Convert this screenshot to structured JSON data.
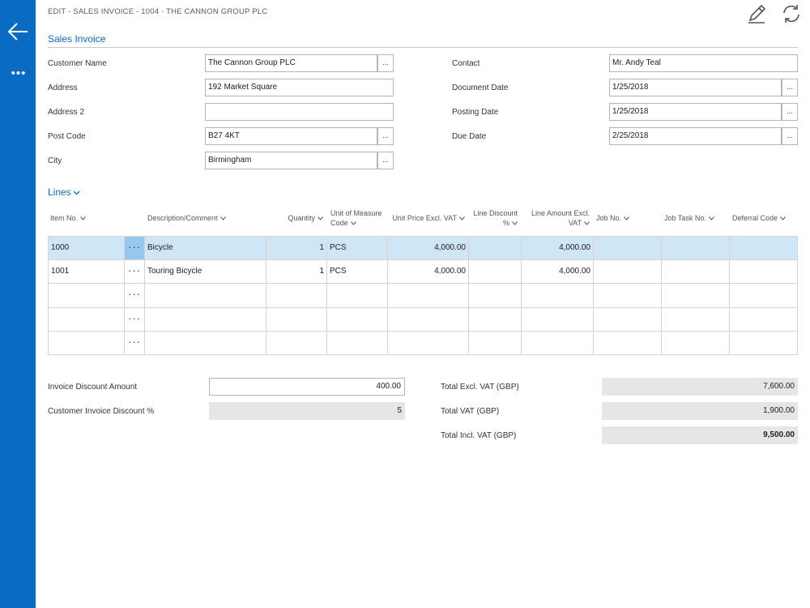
{
  "breadcrumb": "EDIT - SALES INVOICE - 1004 · THE CANNON GROUP PLC",
  "icons": {
    "back": "arrow-left-icon",
    "more": "ellipsis-icon",
    "edit": "pencil-icon",
    "refresh": "refresh-icon"
  },
  "sidebar": {
    "more_label": "•••"
  },
  "section": {
    "title": "Sales Invoice"
  },
  "fields": {
    "customer_name": {
      "label": "Customer Name",
      "value": "The Cannon Group PLC"
    },
    "address": {
      "label": "Address",
      "value": "192 Market Square"
    },
    "address2": {
      "label": "Address 2",
      "value": ""
    },
    "post_code": {
      "label": "Post Code",
      "value": "B27 4KT"
    },
    "city": {
      "label": "City",
      "value": "Birmingham"
    },
    "contact": {
      "label": "Contact",
      "value": "Mr. Andy Teal"
    },
    "document_date": {
      "label": "Document Date",
      "value": "1/25/2018"
    },
    "posting_date": {
      "label": "Posting Date",
      "value": "1/25/2018"
    },
    "due_date": {
      "label": "Due Date",
      "value": "2/25/2018"
    }
  },
  "lookup_label": "...",
  "lines": {
    "title": "Lines",
    "columns": {
      "item_no": "Item No.",
      "description": "Description/Comment",
      "quantity": "Quantity",
      "uom_line1": "Unit of Measure",
      "uom_line2": "Code",
      "unit_price": "Unit Price Excl. VAT",
      "line_discount_line1": "Line Discount",
      "line_discount_line2": "%",
      "line_amount_line1": "Line Amount Excl.",
      "line_amount_line2": "VAT",
      "job_no": "Job No.",
      "job_task_no": "Job Task No.",
      "deferral_code": "Deferral Code"
    },
    "row_menu": "···",
    "rows": [
      {
        "item_no": "1000",
        "description": "Bicycle",
        "quantity": "1",
        "uom": "PCS",
        "unit_price": "4,000.00",
        "line_discount": "",
        "line_amount": "4,000.00",
        "job_no": "",
        "job_task_no": "",
        "deferral_code": ""
      },
      {
        "item_no": "1001",
        "description": "Touring Bicycle",
        "quantity": "1",
        "uom": "PCS",
        "unit_price": "4,000.00",
        "line_discount": "",
        "line_amount": "4,000.00",
        "job_no": "",
        "job_task_no": "",
        "deferral_code": ""
      },
      {
        "item_no": "",
        "description": "",
        "quantity": "",
        "uom": "",
        "unit_price": "",
        "line_discount": "",
        "line_amount": "",
        "job_no": "",
        "job_task_no": "",
        "deferral_code": ""
      },
      {
        "item_no": "",
        "description": "",
        "quantity": "",
        "uom": "",
        "unit_price": "",
        "line_discount": "",
        "line_amount": "",
        "job_no": "",
        "job_task_no": "",
        "deferral_code": ""
      },
      {
        "item_no": "",
        "description": "",
        "quantity": "",
        "uom": "",
        "unit_price": "",
        "line_discount": "",
        "line_amount": "",
        "job_no": "",
        "job_task_no": "",
        "deferral_code": ""
      }
    ]
  },
  "totals": {
    "invoice_discount_amount": {
      "label": "Invoice Discount Amount",
      "value": "400.00"
    },
    "customer_invoice_discount_pct": {
      "label": "Customer Invoice Discount %",
      "value": "5"
    },
    "total_excl_vat": {
      "label": "Total Excl. VAT (GBP)",
      "value": "7,600.00"
    },
    "total_vat": {
      "label": "Total VAT (GBP)",
      "value": "1,900.00"
    },
    "total_incl_vat": {
      "label": "Total Incl. VAT (GBP)",
      "value": "9,500.00"
    }
  },
  "colors": {
    "accent": "#0a6bc4",
    "selected_row": "#cfe6f6",
    "selected_menu_cell": "#96c7ec",
    "readonly_box": "#e6e6e6"
  }
}
